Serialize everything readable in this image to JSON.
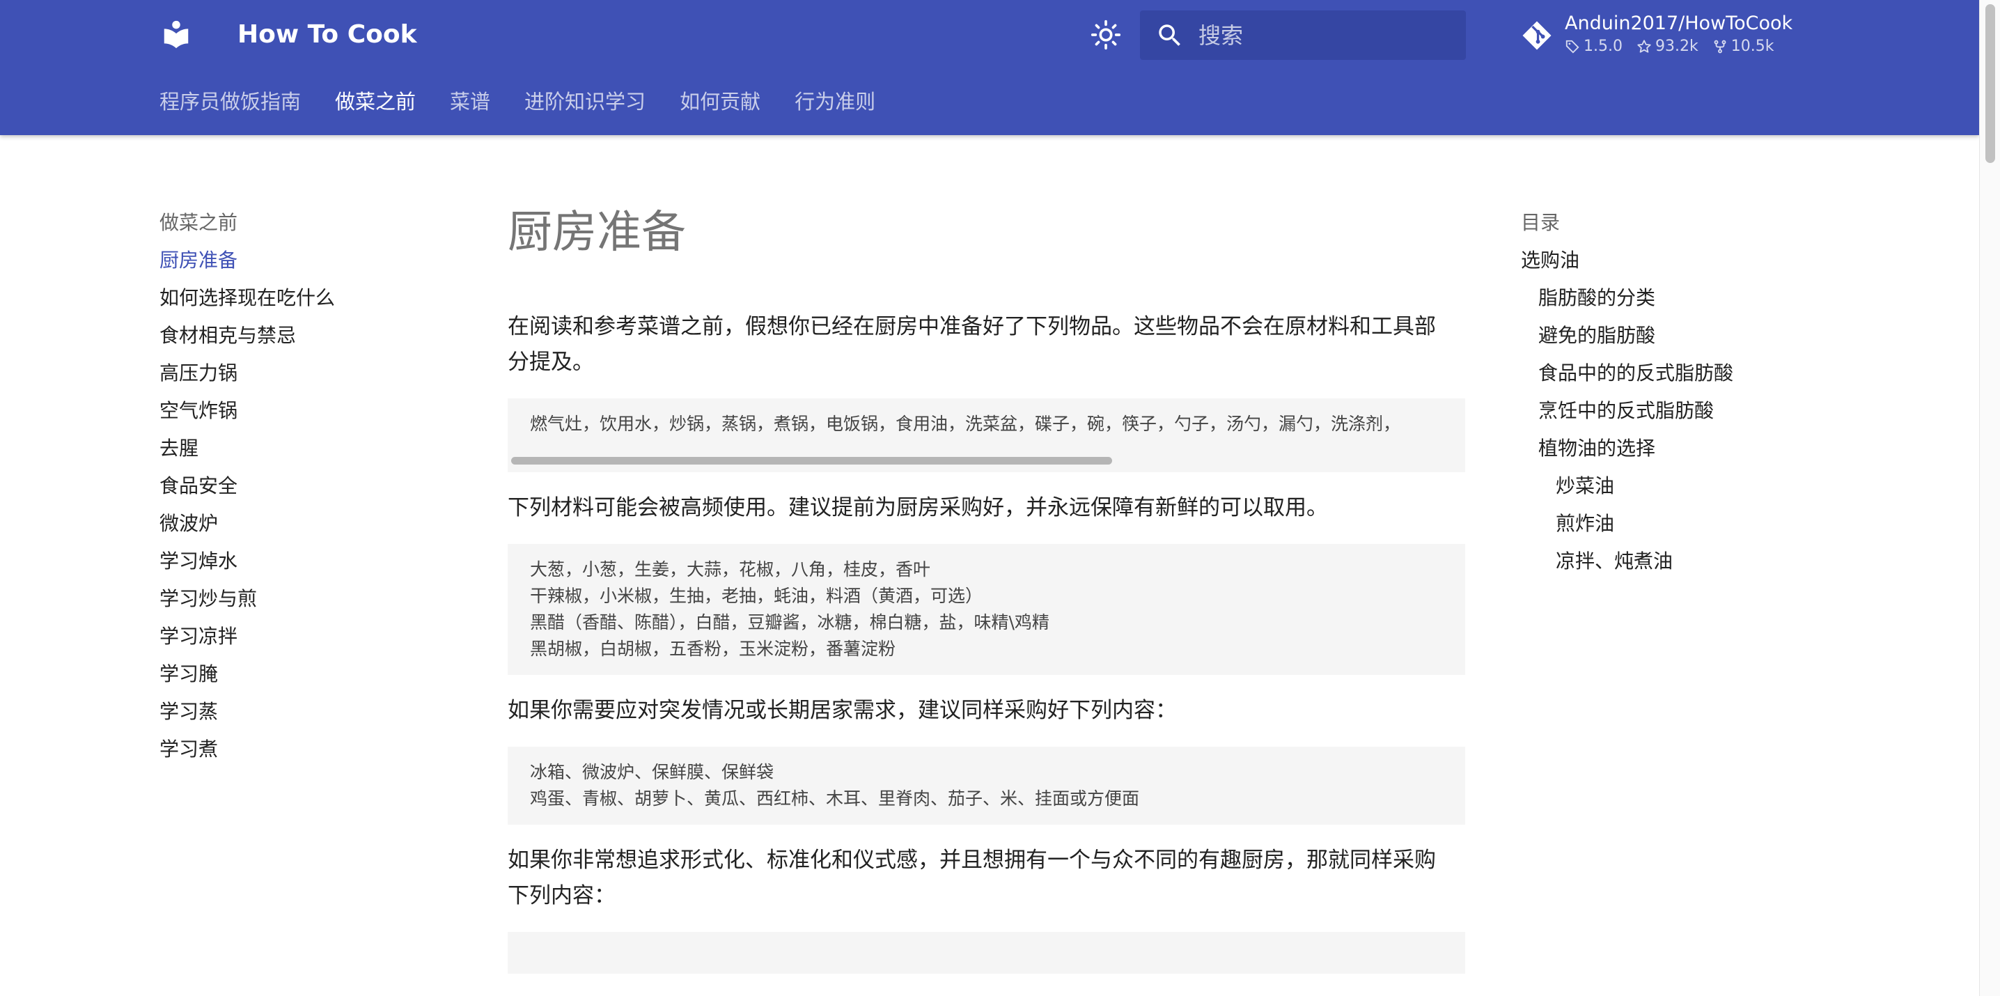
{
  "header": {
    "title": "How To Cook",
    "search_placeholder": "搜索",
    "repo": {
      "name": "Anduin2017/HowToCook",
      "version": "1.5.0",
      "stars": "93.2k",
      "forks": "10.5k"
    },
    "tabs": [
      {
        "label": "程序员做饭指南"
      },
      {
        "label": "做菜之前"
      },
      {
        "label": "菜谱"
      },
      {
        "label": "进阶知识学习"
      },
      {
        "label": "如何贡献"
      },
      {
        "label": "行为准则"
      }
    ],
    "active_tab": "做菜之前"
  },
  "sidebar": {
    "title": "做菜之前",
    "items": [
      {
        "label": "厨房准备"
      },
      {
        "label": "如何选择现在吃什么"
      },
      {
        "label": "食材相克与禁忌"
      },
      {
        "label": "高压力锅"
      },
      {
        "label": "空气炸锅"
      },
      {
        "label": "去腥"
      },
      {
        "label": "食品安全"
      },
      {
        "label": "微波炉"
      },
      {
        "label": "学习焯水"
      },
      {
        "label": "学习炒与煎"
      },
      {
        "label": "学习凉拌"
      },
      {
        "label": "学习腌"
      },
      {
        "label": "学习蒸"
      },
      {
        "label": "学习煮"
      }
    ]
  },
  "main": {
    "title": "厨房准备",
    "intro_line1": "在阅读和参考菜谱之前，假想你已经在厨房中准备好了下列物品。这些物品不会在原材料和工具部",
    "intro_line2": "分提及。",
    "code1": "燃气灶，饮用水，炒锅，蒸锅，煮锅，电饭锅，食用油，洗菜盆，碟子，碗，筷子，勺子，汤勺，漏勺，洗涤剂，",
    "para2": "下列材料可能会被高频使用。建议提前为厨房采购好，并永远保障有新鲜的可以取用。",
    "code2": [
      "大葱，小葱，生姜，大蒜，花椒，八角，桂皮，香叶",
      "干辣椒，小米椒，生抽，老抽，蚝油，料酒（黄酒，可选）",
      "黑醋（香醋、陈醋），白醋，豆瓣酱，冰糖，棉白糖，盐，味精\\鸡精",
      "黑胡椒，白胡椒，五香粉，玉米淀粉，番薯淀粉"
    ],
    "para3": "如果你需要应对突发情况或长期居家需求，建议同样采购好下列内容：",
    "code3": [
      "冰箱、微波炉、保鲜膜、保鲜袋",
      "鸡蛋、青椒、胡萝卜、黄瓜、西红柿、木耳、里脊肉、茄子、米、挂面或方便面"
    ],
    "para4_line1": "如果你非常想追求形式化、标准化和仪式感，并且想拥有一个与众不同的有趣厨房，那就同样采购",
    "para4_line2": "下列内容："
  },
  "toc": {
    "title": "目录",
    "items": [
      {
        "label": "选购油"
      },
      {
        "label": "脂肪酸的分类"
      },
      {
        "label": "避免的脂肪酸"
      },
      {
        "label": "食品中的的反式脂肪酸"
      },
      {
        "label": "烹饪中的反式脂肪酸"
      },
      {
        "label": "植物油的选择"
      },
      {
        "label": "炒菜油"
      },
      {
        "label": "煎炸油"
      },
      {
        "label": "凉拌、炖煮油"
      }
    ]
  },
  "colors": {
    "primary": "#3f51b5",
    "header_text": "#ffffff",
    "active_link": "#3f51b5",
    "code_background": "#f5f5f5",
    "page_title": "#757575"
  },
  "icons": {
    "logo": "book-icon",
    "theme": "brightness-icon",
    "search": "magnifier-icon",
    "repo": "git-icon",
    "version": "tag-icon",
    "stars": "star-icon",
    "forks": "fork-icon"
  }
}
